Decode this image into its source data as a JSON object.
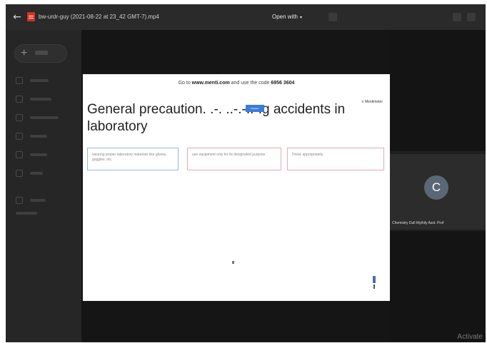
{
  "topbar": {
    "back_label": "←",
    "file_name": "bw-urdr-guy (2021-08-22 at 23_42 GMT-7).mp4",
    "open_with_label": "Open with",
    "open_with_caret": "▾"
  },
  "sidebar": {
    "new_label": "+"
  },
  "slide": {
    "join_prefix": "Go to ",
    "join_site": "www.menti.com",
    "join_middle": " and use the code ",
    "join_code": "6956 3604",
    "brand": "≡ Mentimeter",
    "title": "General precaution. .-. ..-.-..-.g accidents in laboratory",
    "title_overlay": "Register",
    "responses": [
      "wearing proper laboratory materials like gloves, goggles, etc.",
      "use equipment only for its designated purpose",
      "Dress appropriately"
    ]
  },
  "participant": {
    "initial": "C",
    "name": "Chemistry Dull Mythily Asst. Prof",
    "avatar_color": "#5b6775"
  },
  "watermark": "Activate"
}
